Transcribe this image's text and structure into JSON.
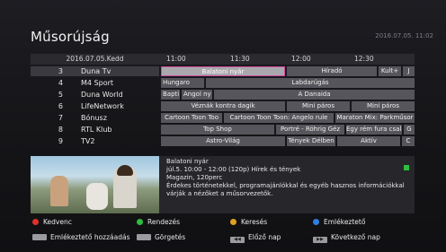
{
  "window": {
    "title": "Műsorújság",
    "datetime": "2016.07.05. 11:02"
  },
  "grid": {
    "date": "2016.07.05.Kedd",
    "times": [
      "11:00",
      "11:30",
      "12:00",
      "12:30"
    ],
    "channels": [
      {
        "num": "3",
        "name": "Duna Tv",
        "selected": true,
        "events": [
          {
            "title": "Balatoni nyár",
            "selected": true
          },
          {
            "title": "Híradó"
          },
          {
            "title": "Kult+"
          },
          {
            "title": "J"
          }
        ]
      },
      {
        "num": "4",
        "name": "M4 Sport",
        "events": [
          {
            "title": "Hungaro"
          },
          {
            "title": "Labdarúgás"
          }
        ]
      },
      {
        "num": "5",
        "name": "Duna World",
        "events": [
          {
            "title": "Bapti"
          },
          {
            "title": "Angol ny"
          },
          {
            "title": "A Danaida"
          }
        ]
      },
      {
        "num": "6",
        "name": "LifeNetwork",
        "events": [
          {
            "title": "Véznák kontra dagik"
          },
          {
            "title": "Mini páros"
          },
          {
            "title": "Mini páros"
          }
        ]
      },
      {
        "num": "7",
        "name": "Bónusz",
        "events": [
          {
            "title": "Cartoon Toon Too"
          },
          {
            "title": "Cartoon Toon Toon: Angelo rule"
          },
          {
            "title": "Maraton Mix: Parkműsor"
          }
        ]
      },
      {
        "num": "8",
        "name": "RTL Klub",
        "events": [
          {
            "title": "Top Shop"
          },
          {
            "title": "Portré - Röhrig Géz"
          },
          {
            "title": "Egy rém fura csalá"
          },
          {
            "title": "G"
          }
        ]
      },
      {
        "num": "9",
        "name": "TV2",
        "events": [
          {
            "title": "Astro-Világ"
          },
          {
            "title": "Tények Délben"
          },
          {
            "title": "Aktív"
          },
          {
            "title": "C"
          }
        ]
      }
    ]
  },
  "info": {
    "title": "Balatoni nyár",
    "line1": "júl.5. 10:00 - 12:00 (120p) Hírek és tények",
    "line2": "Magazin, 120perc",
    "line3": "Érdekes történetekkel, programajánlókkal és egyéb hasznos információkkal",
    "line4": "várják a nézőket a műsorvezetők.",
    "indicator_color": "#2fbd3f"
  },
  "legend": {
    "red": {
      "label": "Kedvenc",
      "color": "#e0302a"
    },
    "green": {
      "label": "Rendezés",
      "color": "#2fbd3f"
    },
    "yellow": {
      "label": "Keresés",
      "color": "#e0a020"
    },
    "blue": {
      "label": "Emlékeztető",
      "color": "#2f7fe0"
    },
    "key1": {
      "label": "Emlékeztető hozzáadás",
      "icon": "ok-key-icon"
    },
    "key2": {
      "label": "Görgetés",
      "icon": "info-key-icon"
    },
    "key3": {
      "label": "Előző nap",
      "icon": "rewind-key-icon"
    },
    "key4": {
      "label": "Következő nap",
      "icon": "forward-key-icon"
    }
  }
}
